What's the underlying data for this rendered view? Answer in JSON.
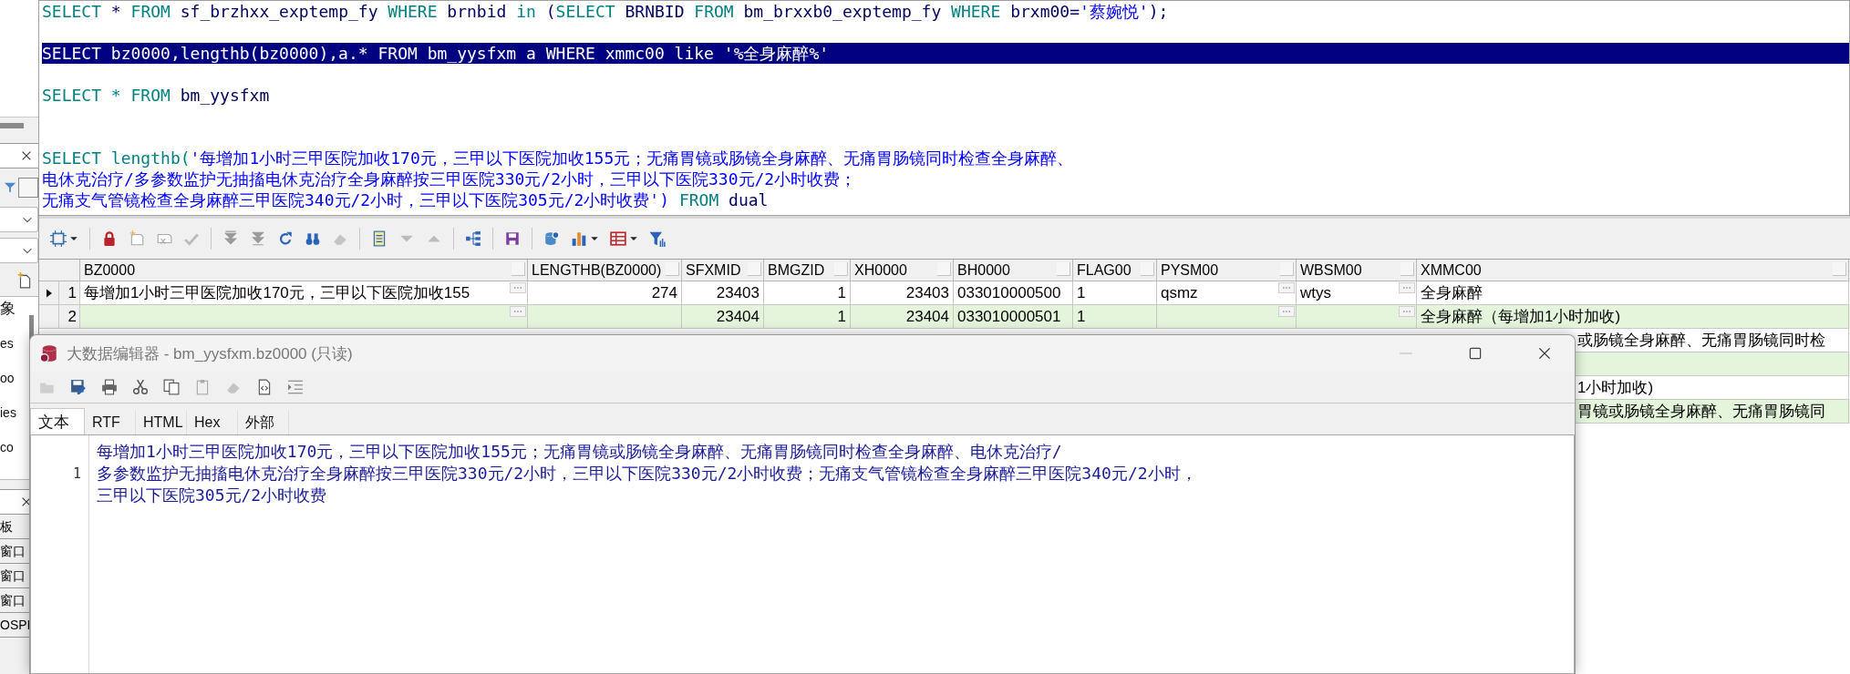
{
  "left_panel": {
    "list_items": [
      "象",
      "es",
      "oo",
      "ies",
      "co"
    ],
    "bottom_items": [
      "板",
      "窗口",
      "窗口",
      "窗口",
      "OSPI"
    ]
  },
  "sql_editor": {
    "lines": [
      {
        "selected": false,
        "tokens": [
          {
            "kind": "keyword",
            "text": "SELECT"
          },
          {
            "kind": "plain",
            "text": " * "
          },
          {
            "kind": "keyword",
            "text": "FROM"
          },
          {
            "kind": "plain",
            "text": " sf_brzhxx_exptemp_fy "
          },
          {
            "kind": "keyword",
            "text": "WHERE"
          },
          {
            "kind": "plain",
            "text": " brnbid "
          },
          {
            "kind": "keyword",
            "text": "in"
          },
          {
            "kind": "plain",
            "text": " ("
          },
          {
            "kind": "keyword",
            "text": "SELECT"
          },
          {
            "kind": "plain",
            "text": " BRNBID "
          },
          {
            "kind": "keyword",
            "text": "FROM"
          },
          {
            "kind": "plain",
            "text": " bm_brxxb0_exptemp_fy "
          },
          {
            "kind": "keyword",
            "text": "WHERE"
          },
          {
            "kind": "plain",
            "text": " brxm00="
          },
          {
            "kind": "string",
            "text": "'蔡婉悦'"
          },
          {
            "kind": "plain",
            "text": ");"
          }
        ]
      },
      {
        "blank": true
      },
      {
        "selected": true,
        "tokens": [
          {
            "kind": "keyword",
            "text": "SELECT"
          },
          {
            "kind": "plain",
            "text": " bz0000,lengthb(bz0000),a.* "
          },
          {
            "kind": "keyword",
            "text": "FROM"
          },
          {
            "kind": "plain",
            "text": " bm_yysfxm a "
          },
          {
            "kind": "keyword",
            "text": "WHERE"
          },
          {
            "kind": "plain",
            "text": " xmmc00 "
          },
          {
            "kind": "keyword",
            "text": "like"
          },
          {
            "kind": "string",
            "text": " '%全身麻醉%'"
          }
        ]
      },
      {
        "blank": true
      },
      {
        "selected": false,
        "tokens": [
          {
            "kind": "keyword",
            "text": "SELECT * FROM"
          },
          {
            "kind": "plain",
            "text": " bm_yysfxm"
          }
        ]
      },
      {
        "blank": true
      },
      {
        "blank": true
      },
      {
        "selected": false,
        "tokens": [
          {
            "kind": "keyword",
            "text": "SELECT lengthb("
          },
          {
            "kind": "string",
            "text": "'每增加1小时三甲医院加收170元，三甲以下医院加收155元；无痛胃镜或肠镜全身麻醉、无痛胃肠镜同时检查全身麻醉、"
          }
        ]
      },
      {
        "selected": false,
        "tokens": [
          {
            "kind": "string",
            "text": "电休克治疗/多参数监护无抽搐电休克治疗全身麻醉按三甲医院330元/2小时，三甲以下医院330元/2小时收费；"
          }
        ]
      },
      {
        "selected": false,
        "tokens": [
          {
            "kind": "string",
            "text": "无痛支气管镜检查全身麻醉三甲医院340元/2小时，三甲以下医院305元/2小时收费')"
          },
          {
            "kind": "keyword",
            "text": " FROM"
          },
          {
            "kind": "plain",
            "text": " dual"
          }
        ]
      }
    ]
  },
  "grid": {
    "columns": [
      {
        "label": "BZ0000",
        "kind": "text",
        "editor_button": true
      },
      {
        "label": "LENGTHB(BZ0000)",
        "kind": "number",
        "editor_button": false
      },
      {
        "label": "SFXMID",
        "kind": "number",
        "editor_button": false
      },
      {
        "label": "BMGZID",
        "kind": "number",
        "editor_button": false
      },
      {
        "label": "XH0000",
        "kind": "number",
        "editor_button": false
      },
      {
        "label": "BH0000",
        "kind": "text",
        "editor_button": false
      },
      {
        "label": "FLAG00",
        "kind": "text",
        "editor_button": false
      },
      {
        "label": "PYSM00",
        "kind": "text",
        "editor_button": true
      },
      {
        "label": "WBSM00",
        "kind": "text",
        "editor_button": true
      },
      {
        "label": "XMMC00",
        "kind": "text",
        "editor_button": false
      }
    ],
    "rows": [
      {
        "kind": "full",
        "number": "1",
        "current": true,
        "cells": [
          "每增加1小时三甲医院加收170元，三甲以下医院加收155",
          "274",
          "23403",
          "1",
          "23403",
          "033010000500",
          "1",
          "qsmz",
          "wtys",
          "全身麻醉"
        ]
      },
      {
        "kind": "full",
        "number": "2",
        "current": false,
        "cells": [
          null,
          null,
          "23404",
          "1",
          "23404",
          "033010000501",
          "1",
          null,
          null,
          "全身麻醉（每增加1小时加收)"
        ]
      },
      {
        "kind": "tail",
        "text": "或肠镜全身麻醉、无痛胃肠镜同时检"
      },
      {
        "kind": "tail"
      },
      {
        "kind": "tail",
        "text": "1小时加收)"
      },
      {
        "kind": "tail",
        "text": "胃镜或肠镜全身麻醉、无痛胃肠镜同"
      }
    ]
  },
  "dialog": {
    "title": "大数据编辑器 - bm_yysfxm.bz0000 (只读)",
    "tabs": [
      {
        "label": "文本",
        "selected": true
      },
      {
        "label": "RTF",
        "selected": false
      },
      {
        "label": "HTML",
        "selected": false
      },
      {
        "label": "Hex",
        "selected": false
      },
      {
        "label": "外部",
        "selected": false
      }
    ],
    "line_number": "1",
    "text_lines": [
      "每增加1小时三甲医院加收170元，三甲以下医院加收155元；无痛胃镜或肠镜全身麻醉、无痛胃肠镜同时检查全身麻醉、电休克治疗/",
      "多参数监护无抽搐电休克治疗全身麻醉按三甲医院330元/2小时，三甲以下医院330元/2小时收费；无痛支气管镜检查全身麻醉三甲医院340元/2小时，",
      "三甲以下医院305元/2小时收费"
    ]
  }
}
